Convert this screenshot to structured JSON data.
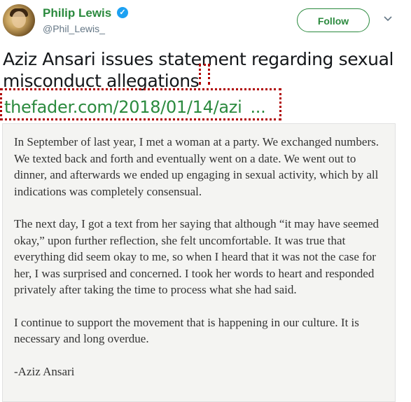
{
  "tweet": {
    "author": {
      "display_name": "Philip Lewis",
      "handle": "@Phil_Lewis_",
      "verified": true,
      "avatar_icon": "user-avatar-icon"
    },
    "follow_label": "Follow",
    "text": "Aziz Ansari issues statement regarding sexual misconduct allegations",
    "link": {
      "text": "thefader.com/2018/01/14/azi",
      "ellipsis": "..."
    },
    "image_card": {
      "paragraphs": [
        "In September of last year, I met a woman at a party. We exchanged numbers. We texted back and forth and eventually went on a date. We went out to dinner, and afterwards we ended up engaging in sexual activity, which by all indications was completely consensual.",
        "The next day, I got a text from her saying that although “it may have seemed okay,” upon further reflection, she felt uncomfortable. It was true that everything did seem okay to me, so when I heard that it was not the case for her, I was surprised and concerned. I took her words to heart and responded privately after taking the time to process what she had said.",
        "I continue to support the movement that is happening in our culture. It is necessary and long overdue."
      ],
      "signature": "-Aziz Ansari"
    }
  },
  "colors": {
    "accent": "#2b8a3e",
    "verified": "#1da1f2",
    "annotation": "#b00000",
    "card_bg": "#f4f4f2"
  }
}
